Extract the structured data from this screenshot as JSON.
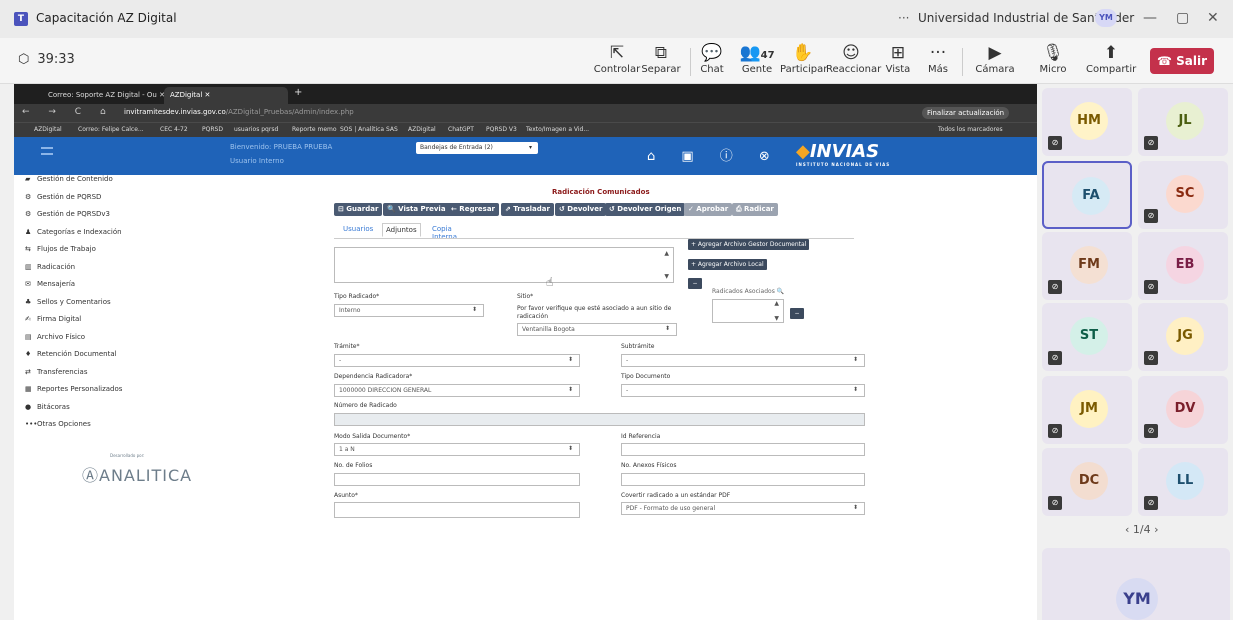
{
  "teams": {
    "title": "Capacitación AZ Digital",
    "logo": "T",
    "org_prefix": "···",
    "org": "Universidad Industrial de Santander",
    "user_initials": "YM",
    "window_controls": [
      "—",
      "▢",
      "✕"
    ]
  },
  "meeting": {
    "timer": "39:33",
    "timer_icon": "shield-icon",
    "buttons": [
      {
        "label": "Controlar",
        "icon": "⇱"
      },
      {
        "label": "Separar",
        "icon": "⧉"
      },
      {
        "label": "Chat",
        "icon": "💬"
      },
      {
        "label": "Gente",
        "icon": "👥",
        "count": "47"
      },
      {
        "label": "Participar",
        "icon": "✋"
      },
      {
        "label": "Reaccionar",
        "icon": "☺"
      },
      {
        "label": "Vista",
        "icon": "⊞"
      },
      {
        "label": "Más",
        "icon": "···"
      },
      {
        "label": "Cámara",
        "icon": "▶"
      },
      {
        "label": "Micro",
        "icon": "🎙"
      },
      {
        "label": "Compartir",
        "icon": "⬆"
      }
    ],
    "leave": "Salir"
  },
  "browser": {
    "tabs": [
      {
        "label": "Correo: Soporte AZ Digital - Ou ✕"
      },
      {
        "label": "AZDigital                                ✕"
      }
    ],
    "nav_icons": "← → C ⌂",
    "url_host": "invitramitesdev.invias.gov.co",
    "url_path": "/AZDigital_Pruebas/Admin/index.php",
    "update_btn": "Finalizar actualización",
    "bookmarks": [
      "AZDigital",
      "Correo: Felipe Calce...",
      "CEC 4-72",
      "PQRSD",
      "usuarios pqrsd",
      "Reporte memo",
      "SOS | Analítica SAS",
      "AZDigital",
      "ChatGPT",
      "PQRSD V3",
      "Texto/Imagen a Vid..."
    ],
    "bookmarks_right": "Todos los marcadores"
  },
  "app": {
    "welcome": "Bienvenido: PRUEBA PRUEBA",
    "role": "Usuario Interno",
    "inbox_select": "Bandejas de Entrada (2)",
    "header_icons": "⌂ ▣ ⓘ ⊗",
    "logo_text": "INVIAS",
    "logo_sub": "INSTITUTO NACIONAL DE VIAS",
    "sidebar": [
      {
        "label": "Gestión de Contenido",
        "icon": "▰"
      },
      {
        "label": "Gestión de PQRSD",
        "icon": "⚙"
      },
      {
        "label": "Gestión de PQRSDv3",
        "icon": "⚙"
      },
      {
        "label": "Categorías e Indexación",
        "icon": "♟"
      },
      {
        "label": "Flujos de Trabajo",
        "icon": "⇆"
      },
      {
        "label": "Radicación",
        "icon": "▥"
      },
      {
        "label": "Mensajería",
        "icon": "✉"
      },
      {
        "label": "Sellos y Comentarios",
        "icon": "♣"
      },
      {
        "label": "Firma Digital",
        "icon": "✍"
      },
      {
        "label": "Archivo Físico",
        "icon": "▤"
      },
      {
        "label": "Retención Documental",
        "icon": "♦"
      },
      {
        "label": "Transferencias",
        "icon": "⇄"
      },
      {
        "label": "Reportes Personalizados",
        "icon": "▦"
      },
      {
        "label": "Bitácoras",
        "icon": "●"
      },
      {
        "label": "Otras Opciones",
        "icon": "•••"
      }
    ],
    "brand": "ANALITICA",
    "brand_sub": "Desarrollado por:"
  },
  "form": {
    "title": "Radicación Comunicados",
    "toolbar": [
      {
        "label": "⊟ Guardar",
        "disabled": false
      },
      {
        "label": "🔍 Vista Previa",
        "disabled": false
      },
      {
        "label": "← Regresar",
        "disabled": false
      },
      {
        "label": "⇗ Trasladar",
        "disabled": false
      },
      {
        "label": "↺ Devolver",
        "disabled": false
      },
      {
        "label": "↺ Devolver Origen",
        "disabled": false
      },
      {
        "label": "✓ Aprobar",
        "disabled": true
      },
      {
        "label": "⎙ Radicar",
        "disabled": true
      }
    ],
    "tabs": [
      "Usuarios",
      "Adjuntos",
      "Copia Interna"
    ],
    "attach_gestor": "+ Agregar Archivo Gestor Documental",
    "attach_local": "+ Agregar Archivo Local",
    "minus": "−",
    "tipo_radicado_label": "Tipo Radicado*",
    "tipo_radicado_value": "Interno",
    "sitio_label": "Sitio*",
    "sitio_help": "Por favor verifique que esté asociado a aun sitio de radicación",
    "sitio_value": "Ventanilla Bogota",
    "radicados_asociados": "Radicados Asociados",
    "tramite_label": "Trámite*",
    "tramite_value": "-",
    "subtramite_label": "Subtrámite",
    "subtramite_value": "-",
    "dependencia_label": "Dependencia Radicadora*",
    "dependencia_value": "1000000 DIRECCION GENERAL",
    "tipo_documento_label": "Tipo Documento",
    "tipo_documento_value": "-",
    "numero_radicado_label": "Número de Radicado",
    "modo_salida_label": "Modo Salida Documento*",
    "modo_salida_value": "1 a N",
    "id_referencia_label": "Id Referencia",
    "folios_label": "No. de Folios",
    "anexos_label": "No. Anexos Físicos",
    "asunto_label": "Asunto*",
    "pdf_label": "Covertir radicado a un estándar PDF",
    "pdf_value": "PDF - Formato de uso general"
  },
  "participants": [
    {
      "initials": "HM",
      "bg": "#fff3c8",
      "fg": "#7a5a00",
      "muted": true
    },
    {
      "initials": "JL",
      "bg": "#e8f0d2",
      "fg": "#4a5e10",
      "muted": true
    },
    {
      "initials": "FA",
      "bg": "#d6eaf5",
      "fg": "#1e4f6e",
      "muted": false,
      "selected": true
    },
    {
      "initials": "SC",
      "bg": "#fbd9cf",
      "fg": "#8a2a10",
      "muted": true
    },
    {
      "initials": "FM",
      "bg": "#f4e0d3",
      "fg": "#6e3a1a",
      "muted": true
    },
    {
      "initials": "EB",
      "bg": "#f5d5e2",
      "fg": "#7a1e46",
      "muted": true
    },
    {
      "initials": "ST",
      "bg": "#d4f0e8",
      "fg": "#0e5e48",
      "muted": true
    },
    {
      "initials": "JG",
      "bg": "#fff0c4",
      "fg": "#7a5a00",
      "muted": true
    },
    {
      "initials": "JM",
      "bg": "#fff2c2",
      "fg": "#7a5a00",
      "muted": true
    },
    {
      "initials": "DV",
      "bg": "#f6d4d8",
      "fg": "#7a1e2a",
      "muted": true
    },
    {
      "initials": "DC",
      "bg": "#f3ddd0",
      "fg": "#6e3a1a",
      "muted": true
    },
    {
      "initials": "LL",
      "bg": "#d4e8f6",
      "fg": "#1e4f6e",
      "muted": true
    }
  ],
  "pager": "1/4",
  "self_initials": "YM"
}
